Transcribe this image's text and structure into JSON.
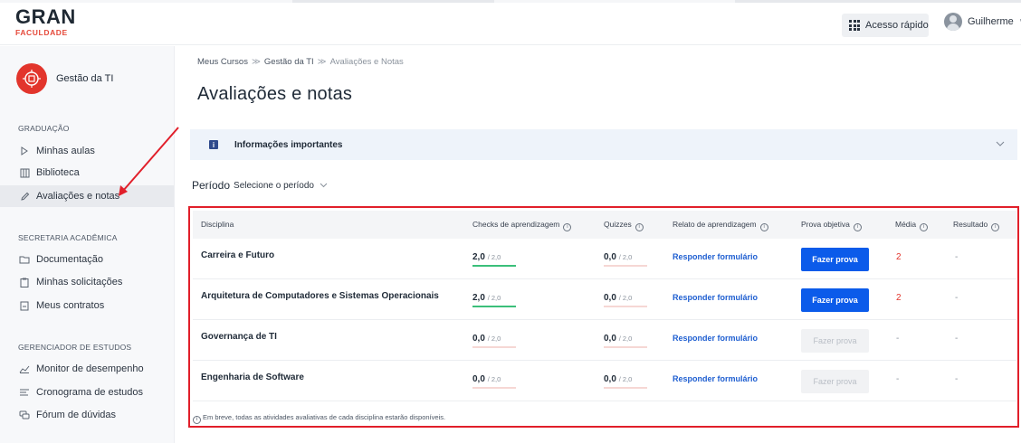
{
  "header": {
    "logo_main": "GRAN",
    "logo_sub": "FACULDADE",
    "quick_access_label": "Acesso rápido",
    "user_name": "Guilherme",
    "user_chevron": "∨"
  },
  "sidebar": {
    "course_name": "Gestão da TI",
    "sections": [
      {
        "title": "GRADUAÇÃO",
        "items": [
          {
            "label": "Minhas aulas",
            "icon": "play-outline-icon"
          },
          {
            "label": "Biblioteca",
            "icon": "book-icon"
          },
          {
            "label": "Avaliações e notas",
            "icon": "pencil-icon",
            "active": true
          }
        ]
      },
      {
        "title": "SECRETARIA ACADÊMICA",
        "items": [
          {
            "label": "Documentação",
            "icon": "folder-icon"
          },
          {
            "label": "Minhas solicitações",
            "icon": "clipboard-icon"
          },
          {
            "label": "Meus contratos",
            "icon": "document-icon"
          }
        ]
      },
      {
        "title": "GERENCIADOR DE ESTUDOS",
        "items": [
          {
            "label": "Monitor de desempenho",
            "icon": "chart-line-icon"
          },
          {
            "label": "Cronograma de estudos",
            "icon": "schedule-icon"
          },
          {
            "label": "Fórum de dúvidas",
            "icon": "chat-icon"
          }
        ]
      }
    ]
  },
  "breadcrumb": [
    "Meus Cursos",
    "Gestão da TI",
    "Avaliações e Notas"
  ],
  "breadcrumb_sep": "≫",
  "page_title": "Avaliações e notas",
  "info_bar": {
    "icon_text": "i",
    "title": "Informações importantes"
  },
  "period": {
    "label": "Período",
    "placeholder": "Selecione o período"
  },
  "table": {
    "headers": [
      "Disciplina",
      "Checks de aprendizagem",
      "Quizzes",
      "Relato de aprendizagem",
      "Prova objetiva",
      "Média",
      "Resultado"
    ],
    "header_help_glyph": "i",
    "rows": [
      {
        "disciplina": "Carreira e Futuro",
        "checks": {
          "value": "2,0",
          "max": "/ 2,0",
          "fraction": 1.0
        },
        "quizzes": {
          "value": "0,0",
          "max": "/ 2,0",
          "fraction": 0.0
        },
        "relato": "Responder formulário",
        "prova": "Fazer prova",
        "prova_enabled": true,
        "media": "2",
        "resultado": "-"
      },
      {
        "disciplina": "Arquitetura de Computadores e Sistemas Operacionais",
        "checks": {
          "value": "2,0",
          "max": "/ 2,0",
          "fraction": 1.0
        },
        "quizzes": {
          "value": "0,0",
          "max": "/ 2,0",
          "fraction": 0.0
        },
        "relato": "Responder formulário",
        "prova": "Fazer prova",
        "prova_enabled": true,
        "media": "2",
        "resultado": "-"
      },
      {
        "disciplina": "Governança de TI",
        "checks": {
          "value": "0,0",
          "max": "/ 2,0",
          "fraction": 0.0
        },
        "quizzes": {
          "value": "0,0",
          "max": "/ 2,0",
          "fraction": 0.0
        },
        "relato": "Responder formulário",
        "prova": "Fazer prova",
        "prova_enabled": false,
        "media": "-",
        "resultado": "-"
      },
      {
        "disciplina": "Engenharia de Software",
        "checks": {
          "value": "0,0",
          "max": "/ 2,0",
          "fraction": 0.0
        },
        "quizzes": {
          "value": "0,0",
          "max": "/ 2,0",
          "fraction": 0.0
        },
        "relato": "Responder formulário",
        "prova": "Fazer prova",
        "prova_enabled": false,
        "media": "-",
        "resultado": "-"
      }
    ],
    "footnote": "Em breve, todas as atividades avaliativas de cada disciplina estarão disponíveis."
  },
  "colors": {
    "accent_blue": "#0b5bea",
    "link_blue": "#1f5fd1",
    "grade_red": "#e2352c",
    "progress_green": "#3bbf7a",
    "progress_empty": "#f6d7d4",
    "annotation_red": "#e11f2a",
    "info_bg": "#eef3fa"
  }
}
